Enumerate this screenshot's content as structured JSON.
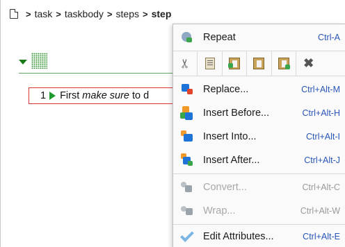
{
  "breadcrumb": {
    "items": [
      "task",
      "taskbody",
      "steps"
    ],
    "current": "step",
    "separator": ">"
  },
  "editor": {
    "step_number": "1",
    "step_text_before": "First ",
    "step_text_em": "make sure",
    "step_text_after": " to d"
  },
  "menu": {
    "repeat": {
      "label": "Repeat",
      "shortcut": "Ctrl-A"
    },
    "toolbar_icons": [
      "cut-icon",
      "copy-icon",
      "paste-before-icon",
      "paste-icon",
      "paste-after-icon",
      "delete-icon"
    ],
    "replace": {
      "label": "Replace...",
      "shortcut": "Ctrl+Alt-M"
    },
    "insert_before": {
      "label": "Insert Before...",
      "shortcut": "Ctrl+Alt-H"
    },
    "insert_into": {
      "label": "Insert Into...",
      "shortcut": "Ctrl+Alt-I"
    },
    "insert_after": {
      "label": "Insert After...",
      "shortcut": "Ctrl+Alt-J"
    },
    "convert": {
      "label": "Convert...",
      "shortcut": "Ctrl+Alt-C",
      "disabled": true
    },
    "wrap": {
      "label": "Wrap...",
      "shortcut": "Ctrl+Alt-W",
      "disabled": true
    },
    "edit_attributes": {
      "label": "Edit Attributes...",
      "shortcut": "Ctrl+Alt-E"
    }
  },
  "colors": {
    "shortcut": "#2855b8",
    "disabled": "#a8a8a8",
    "accent_green": "#1e9a2e",
    "step_border": "#dd3333"
  }
}
